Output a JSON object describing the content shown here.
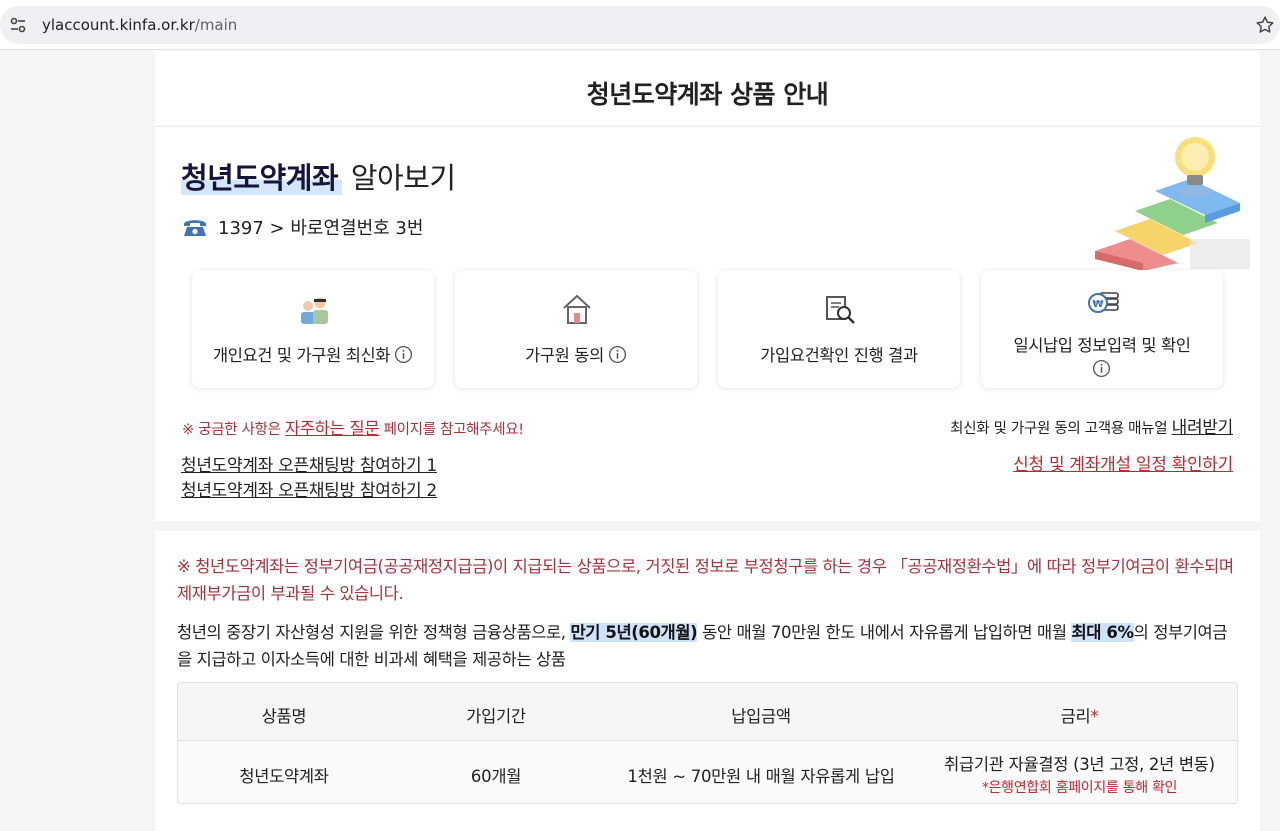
{
  "browser": {
    "url_host": "ylaccount.kinfa.or.kr",
    "url_path": "/main"
  },
  "page": {
    "title": "청년도약계좌 상품 안내"
  },
  "hero": {
    "title_highlight": "청년도약계좌",
    "title_rest": "알아보기",
    "phone_text": "1397 > 바로연결번호 3번"
  },
  "tiles": [
    {
      "label": "개인요건 및 가구원 최신화",
      "icon": "family-icon"
    },
    {
      "label": "가구원 동의",
      "icon": "house-icon"
    },
    {
      "label": "가입요건확인 진행 결과",
      "icon": "document-search-icon"
    },
    {
      "label": "일시납입 정보입력 및 확인",
      "icon": "won-coins-icon"
    }
  ],
  "links": {
    "note_prefix": "※ 궁금한 사항은 ",
    "faq_link": "자주하는 질문",
    "note_suffix": " 페이지를 참고해주세요!",
    "manual_text": "최신화 및 가구원 동의 고객용 매뉴얼 ",
    "manual_link": "내려받기",
    "chat1": "청년도약계좌 오픈채팅방 참여하기 1",
    "chat2": "청년도약계좌 오픈채팅방 참여하기 2",
    "schedule": "신청 및 계좌개설 일정 확인하기"
  },
  "info": {
    "warning": "※ 청년도약계좌는 정부기여금(공공재정지급금)이 지급되는 상품으로, 거짓된 정보로 부정청구를 하는 경우 「공공재정환수법」에 따라 정부기여금이 환수되며 제재부가금이 부과될 수 있습니다.",
    "desc_part1": "청년의 중장기 자산형성 지원을 위한 정책형 금융상품으로, ",
    "desc_hl1": "만기 5년(60개월)",
    "desc_part2": " 동안 매월 70만원 한도 내에서 자유롭게 납입하면 매월 ",
    "desc_hl2": "최대 6%",
    "desc_part3": "의 정부기여금을 지급하고 이자소득에 대한 비과세 혜택을 제공하는 상품"
  },
  "table": {
    "headers": [
      "상품명",
      "가입기간",
      "납입금액",
      "금리"
    ],
    "required_mark": "*",
    "row": {
      "name": "청년도약계좌",
      "period": "60개월",
      "amount": "1천원 ~ 70만원 내 매월 자유롭게 납입",
      "rate": "취급기관 자율결정 (3년 고정, 2년 변동)",
      "rate_note": "*은행연합회 홈페이지를 통해 확인"
    }
  }
}
